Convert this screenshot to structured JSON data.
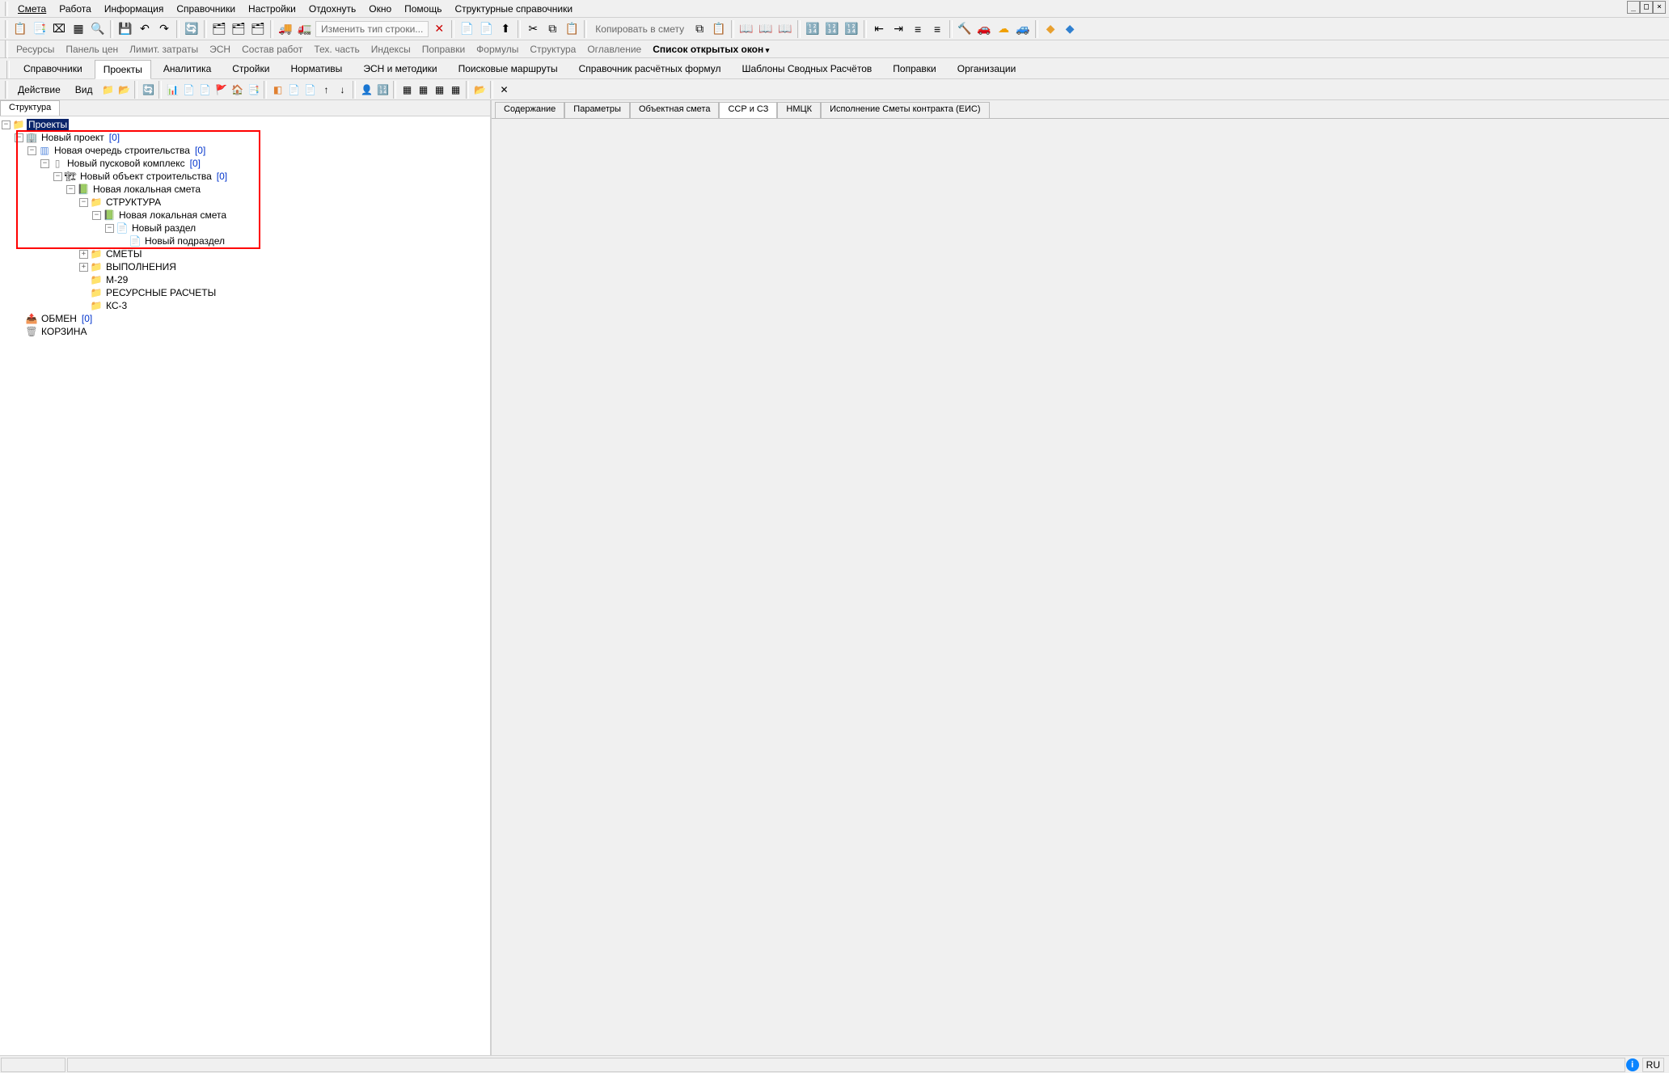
{
  "menubar": [
    "Смета",
    "Работа",
    "Информация",
    "Справочники",
    "Настройки",
    "Отдохнуть",
    "Окно",
    "Помощь",
    "Структурные справочники"
  ],
  "menubar_underline": [
    0,
    -1,
    -1,
    -1,
    -1,
    -1,
    -1,
    -1,
    -1
  ],
  "toolbar1": {
    "change_type": "Изменить тип строки...",
    "copy_to": "Копировать в смету"
  },
  "textbar": {
    "items": [
      "Ресурсы",
      "Панель цен",
      "Лимит. затраты",
      "ЭСН",
      "Состав работ",
      "Тех. часть",
      "Индексы",
      "Поправки",
      "Формулы",
      "Структура",
      "Оглавление"
    ],
    "open_windows": "Список открытых окон"
  },
  "main_tabs": [
    "Справочники",
    "Проекты",
    "Аналитика",
    "Стройки",
    "Нормативы",
    "ЭСН и методики",
    "Поисковые маршруты",
    "Справочник расчётных формул",
    "Шаблоны Сводных Расчётов",
    "Поправки",
    "Организации"
  ],
  "main_tabs_active": 1,
  "toolbar2": {
    "action": "Действие",
    "view": "Вид"
  },
  "left_tab": "Структура",
  "tree": {
    "root": {
      "label": "Проекты",
      "selected": true
    },
    "n1": {
      "label": "Новый проект",
      "count": "[0]"
    },
    "n2": {
      "label": "Новая очередь строительства",
      "count": "[0]"
    },
    "n3": {
      "label": "Новый пусковой комплекс",
      "count": "[0]"
    },
    "n4": {
      "label": "Новый объект строительства",
      "count": "[0]"
    },
    "n5": {
      "label": "Новая локальная смета"
    },
    "n6": {
      "label": "СТРУКТУРА"
    },
    "n7": {
      "label": "Новая локальная смета"
    },
    "n8": {
      "label": "Новый раздел"
    },
    "n9": {
      "label": "Новый подраздел"
    },
    "n10": {
      "label": "СМЕТЫ"
    },
    "n11": {
      "label": "ВЫПОЛНЕНИЯ"
    },
    "n12": {
      "label": "М-29"
    },
    "n13": {
      "label": "РЕСУРСНЫЕ РАСЧЕТЫ"
    },
    "n14": {
      "label": "КС-3"
    },
    "n15": {
      "label": "ОБМЕН",
      "count": "[0]"
    },
    "n16": {
      "label": "КОРЗИНА"
    }
  },
  "right_tabs": [
    "Содержание",
    "Параметры",
    "Объектная смета",
    "ССР и СЗ",
    "НМЦК",
    "Исполнение Сметы контракта (ЕИС)"
  ],
  "right_tabs_active": 3,
  "status": {
    "lang": "RU"
  }
}
